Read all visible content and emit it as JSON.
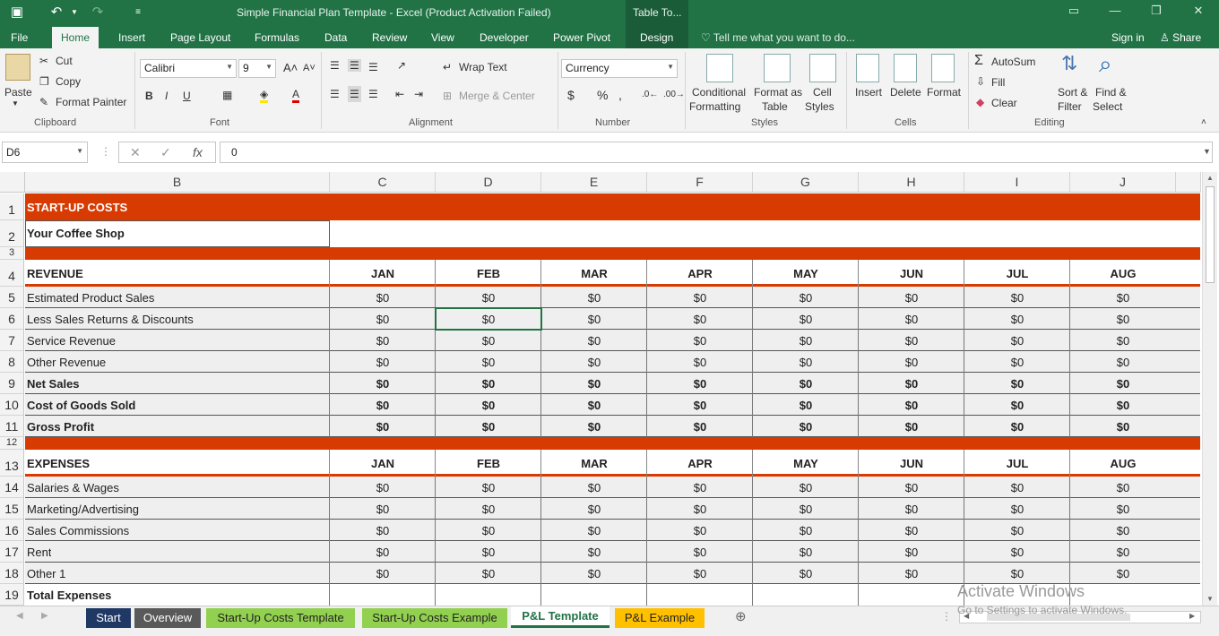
{
  "window": {
    "title": "Simple Financial Plan Template - Excel (Product Activation Failed)",
    "context_tab": "Table To..."
  },
  "ribbon_tabs": [
    "File",
    "Home",
    "Insert",
    "Page Layout",
    "Formulas",
    "Data",
    "Review",
    "View",
    "Developer",
    "Power Pivot",
    "Design"
  ],
  "active_tab": "Home",
  "tell_me": "Tell me what you want to do...",
  "sign_in": "Sign in",
  "share": "Share",
  "clipboard": {
    "paste": "Paste",
    "cut": "Cut",
    "copy": "Copy",
    "format_painter": "Format Painter",
    "label": "Clipboard"
  },
  "font": {
    "name": "Calibri",
    "size": "9",
    "label": "Font"
  },
  "alignment": {
    "wrap": "Wrap Text",
    "merge": "Merge & Center",
    "label": "Alignment"
  },
  "number": {
    "format": "Currency",
    "label": "Number"
  },
  "styles": {
    "cond1": "Conditional",
    "cond2": "Formatting",
    "fmt1": "Format as",
    "fmt2": "Table",
    "cell1": "Cell",
    "cell2": "Styles",
    "label": "Styles"
  },
  "cells": {
    "insert": "Insert",
    "delete": "Delete",
    "format": "Format",
    "label": "Cells"
  },
  "editing": {
    "autosum": "AutoSum",
    "fill": "Fill",
    "clear": "Clear",
    "sort1": "Sort &",
    "sort2": "Filter",
    "find1": "Find &",
    "find2": "Select",
    "label": "Editing"
  },
  "formula": {
    "name_box": "D6",
    "value": "0"
  },
  "columns": [
    "B",
    "C",
    "D",
    "E",
    "F",
    "G",
    "H",
    "I",
    "J"
  ],
  "months": [
    "JAN",
    "FEB",
    "MAR",
    "APR",
    "MAY",
    "JUN",
    "JUL",
    "AUG"
  ],
  "sheet": {
    "title": "START-UP COSTS",
    "subtitle": "Your Coffee Shop",
    "revenue_header": "REVENUE",
    "revenue_rows": [
      {
        "row": "5",
        "label": "Estimated Product Sales",
        "bold": false
      },
      {
        "row": "6",
        "label": "Less Sales Returns & Discounts",
        "bold": false
      },
      {
        "row": "7",
        "label": "Service Revenue",
        "bold": false
      },
      {
        "row": "8",
        "label": "Other Revenue",
        "bold": false
      },
      {
        "row": "9",
        "label": "Net Sales",
        "bold": true
      },
      {
        "row": "10",
        "label": "Cost of Goods Sold",
        "bold": true
      },
      {
        "row": "11",
        "label": "Gross Profit",
        "bold": true
      }
    ],
    "expenses_header": "EXPENSES",
    "expense_rows": [
      {
        "row": "14",
        "label": "Salaries & Wages"
      },
      {
        "row": "15",
        "label": "Marketing/Advertising"
      },
      {
        "row": "16",
        "label": "Sales Commissions"
      },
      {
        "row": "17",
        "label": "Rent"
      },
      {
        "row": "18",
        "label": "Other 1"
      }
    ],
    "total_expenses": "Total Expenses",
    "value": "$0"
  },
  "sheet_tabs": [
    {
      "label": "Start",
      "bg": "#1f3864",
      "fg": "#ffffff"
    },
    {
      "label": "Overview",
      "bg": "#595959",
      "fg": "#ffffff"
    },
    {
      "label": "Start-Up Costs Template",
      "bg": "#92d050",
      "fg": "#222222"
    },
    {
      "label": "Start-Up Costs Example",
      "bg": "#92d050",
      "fg": "#222222"
    },
    {
      "label": "P&L Template",
      "bg": "#ffffff",
      "fg": "#217346"
    },
    {
      "label": "P&L Example",
      "bg": "#ffc000",
      "fg": "#222222"
    }
  ],
  "watermark": {
    "line1": "Activate Windows",
    "line2": "Go to Settings to activate Windows."
  },
  "colors": {
    "accent": "#d83b01",
    "excel_green": "#217346"
  }
}
